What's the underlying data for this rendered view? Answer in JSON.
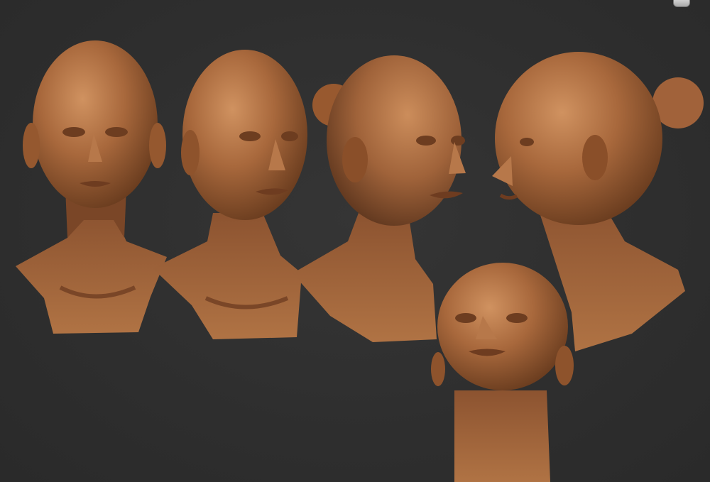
{
  "scene": {
    "background_color": "#2f2f2f",
    "material_color": "#a8683c",
    "highlight_color": "#c98a55",
    "shadow_color": "#6a3d1f",
    "views": [
      {
        "name": "front-view",
        "view": "front"
      },
      {
        "name": "three-quarter-right-view",
        "view": "three-quarter"
      },
      {
        "name": "right-turn-view",
        "view": "three-quarter-turned"
      },
      {
        "name": "left-profile-view",
        "view": "profile-left"
      },
      {
        "name": "upward-view",
        "view": "looking-up"
      }
    ]
  },
  "corner_widget": {
    "icon": "viewport-gizmo-icon"
  }
}
